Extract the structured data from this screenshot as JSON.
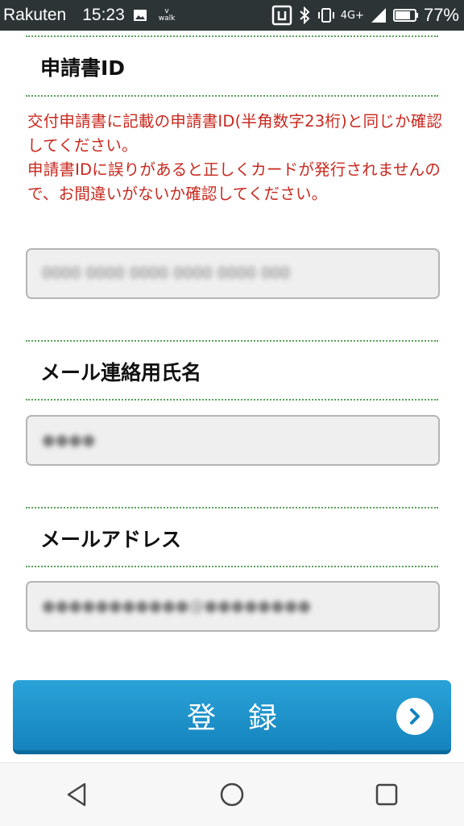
{
  "status_bar": {
    "carrier": "Rakuten",
    "time": "15:23",
    "walk_label_top": "v",
    "walk_label_bottom": "walk",
    "network": "4G+",
    "battery": "77%"
  },
  "form": {
    "application_id": {
      "heading": "申請書ID",
      "notice_lines": [
        "交付申請書に記載の申請書ID(半角数字23桁)と同じか確認してください。",
        "申請書IDに誤りがあると正しくカードが発行されませんので、お間違いがないか確認してください。"
      ],
      "value": "0000 0000 0000 0000 0000 000"
    },
    "mail_name": {
      "heading": "メール連絡用氏名",
      "value": "●●●●"
    },
    "mail_address": {
      "heading": "メールアドレス",
      "value": "●●●●●●●●●●●@●●●●●●●●"
    },
    "submit_label": "登録"
  },
  "colors": {
    "notice": "#c8281e",
    "divider": "#58a05a",
    "button": "#1f95d0"
  },
  "icons": {
    "gallery": "image-icon",
    "walk": "walk-icon",
    "nfc": "nfc-icon",
    "bluetooth": "bluetooth-icon",
    "vibrate": "vibrate-icon",
    "signal": "signal-icon",
    "battery": "battery-icon",
    "submit": "chevron-right-icon",
    "nav_back": "back-icon",
    "nav_home": "home-icon",
    "nav_recents": "recents-icon"
  }
}
